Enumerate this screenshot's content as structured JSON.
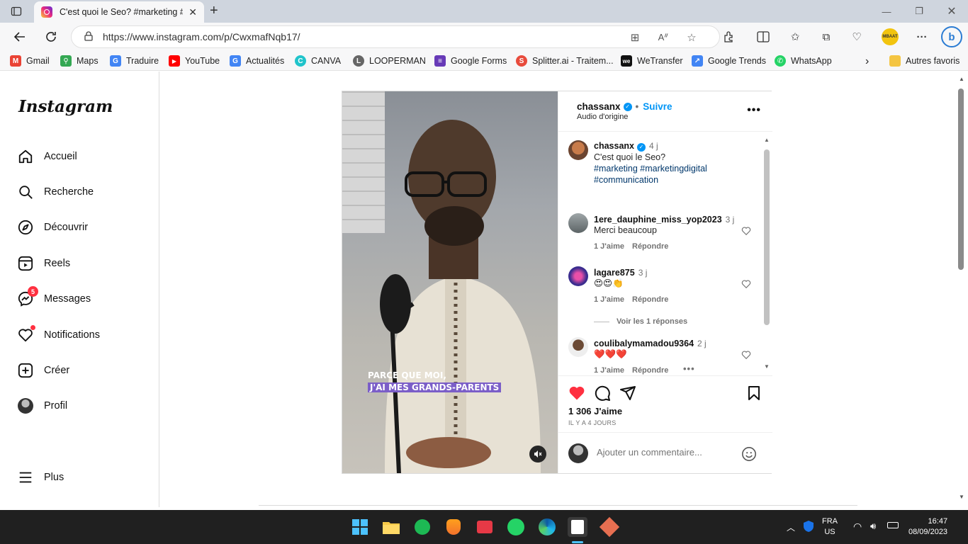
{
  "browser": {
    "tab_title": "C'est quoi le Seo? #marketing #r",
    "url": "https://www.instagram.com/p/CwxmafNqb17/",
    "profile_label": "MBAAT"
  },
  "bookmarks": [
    {
      "label": "Gmail",
      "color": "#ea4335",
      "glyph": "M"
    },
    {
      "label": "Maps",
      "color": "#34a853",
      "glyph": "⚲"
    },
    {
      "label": "Traduire",
      "color": "#4285f4",
      "glyph": "G"
    },
    {
      "label": "YouTube",
      "color": "#ff0000",
      "glyph": "▶"
    },
    {
      "label": "Actualités",
      "color": "#4285f4",
      "glyph": "G"
    },
    {
      "label": "CANVA",
      "color": "#20c4cb",
      "glyph": "C"
    },
    {
      "label": "LOOPERMAN",
      "color": "#666666",
      "glyph": "L"
    },
    {
      "label": "Google Forms",
      "color": "#673ab7",
      "glyph": "≡"
    },
    {
      "label": "Splitter.ai - Traitem...",
      "color": "#e84b3c",
      "glyph": "S"
    },
    {
      "label": "WeTransfer",
      "color": "#111111",
      "glyph": "we"
    },
    {
      "label": "Google Trends",
      "color": "#4285f4",
      "glyph": "↗"
    },
    {
      "label": "WhatsApp",
      "color": "#25d366",
      "glyph": "✆"
    }
  ],
  "other_favorites": "Autres favoris",
  "instagram": {
    "logo": "Instagram",
    "nav": [
      {
        "label": "Accueil",
        "icon": "home-icon"
      },
      {
        "label": "Recherche",
        "icon": "search-icon"
      },
      {
        "label": "Découvrir",
        "icon": "compass-icon"
      },
      {
        "label": "Reels",
        "icon": "reels-icon"
      },
      {
        "label": "Messages",
        "icon": "messenger-icon",
        "badge": "5"
      },
      {
        "label": "Notifications",
        "icon": "heart-icon"
      },
      {
        "label": "Créer",
        "icon": "plus-square-icon"
      },
      {
        "label": "Profil",
        "icon": "profile-avatar"
      }
    ],
    "more": "Plus"
  },
  "post": {
    "video_caption_line1": "PARCE QUE MOI,",
    "video_caption_line2": "J'AI MES GRANDS-PARENTS",
    "author": "chassanx",
    "follow": "Suivre",
    "audio": "Audio d'origine",
    "caption": {
      "user": "chassanx",
      "time": "4 j",
      "text": "C'est quoi le Seo?",
      "hashtags": "#marketing #marketingdigital",
      "hashtags2": "#communication"
    },
    "comments": [
      {
        "user": "1ere_dauphine_miss_yop2023",
        "time": "3 j",
        "text": "Merci beaucoup",
        "likes": "1 J'aime",
        "reply": "Répondre"
      },
      {
        "user": "lagare875",
        "time": "3 j",
        "text": "😍😍👏",
        "likes": "1 J'aime",
        "reply": "Répondre",
        "view_replies": "Voir les 1 réponses"
      },
      {
        "user": "coulibalymamadou9364",
        "time": "2 j",
        "text": "❤️❤️❤️",
        "likes": "1 J'aime",
        "reply": "Répondre"
      }
    ],
    "likes": "1 306 J'aime",
    "date": "IL Y A 4 JOURS",
    "comment_placeholder": "Ajouter un commentaire..."
  },
  "taskbar": {
    "lang1": "FRA",
    "lang2": "US",
    "time": "16:47",
    "date": "08/09/2023"
  }
}
